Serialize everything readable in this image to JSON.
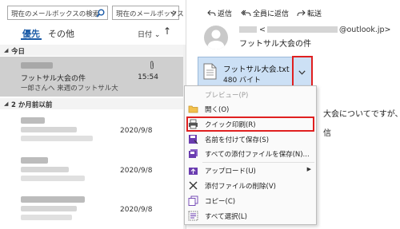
{
  "search": {
    "placeholder": "現在のメールボックスの検索",
    "scope": "現在のメールボックス"
  },
  "tabs": {
    "focused": "優先",
    "other": "その他",
    "sort_by": "日付",
    "sort_dir": "↑"
  },
  "sections": {
    "today": "今日",
    "older": "2 か月前以前"
  },
  "mails": [
    {
      "subject": "フットサル大会の件",
      "preview": "一郎さんへ 来週のフットサル大",
      "time": "15:54"
    },
    {
      "date": "2020/9/8"
    },
    {
      "date": "2020/9/8"
    },
    {
      "date": "2020/9/8"
    }
  ],
  "reading": {
    "reply": "返信",
    "reply_all": "全員に返信",
    "forward": "転送",
    "sender_prefix": "<",
    "sender_domain": "@outlook.jp>",
    "subject": "フットサル大会の件",
    "body_line1": "大会についてですが、",
    "body_line2": "信"
  },
  "attachment": {
    "name": "フットサル大会.txt",
    "size": "480 バイト"
  },
  "context_menu": [
    {
      "label": "プレビュー(P)",
      "icon": "preview-icon",
      "disabled": true
    },
    {
      "label": "開く(O)",
      "icon": "open-folder-icon",
      "disabled": false
    },
    {
      "label": "クイック印刷(R)",
      "icon": "printer-icon",
      "disabled": false
    },
    {
      "label": "名前を付けて保存(S)",
      "icon": "save-as-icon",
      "disabled": false
    },
    {
      "label": "すべての添付ファイルを保存(N)...",
      "icon": "save-all-icon",
      "disabled": false
    },
    {
      "label": "アップロード(U)",
      "icon": "upload-icon",
      "disabled": false
    },
    {
      "label": "添付ファイルの削除(V)",
      "icon": "delete-x-icon",
      "disabled": false
    },
    {
      "label": "コピー(C)",
      "icon": "copy-icon",
      "disabled": false
    },
    {
      "label": "すべて選択(L)",
      "icon": "select-all-icon",
      "disabled": false
    }
  ],
  "colors": {
    "accent": "#1a5aa6",
    "highlight": "#e02020",
    "attachment_bg": "#cce0f5",
    "selected_mail": "#cfcfcf"
  }
}
